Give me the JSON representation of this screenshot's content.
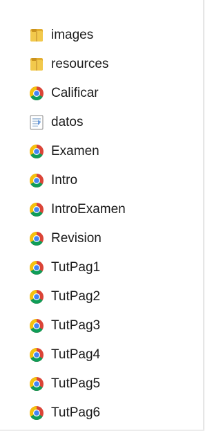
{
  "colors": {
    "folder": "#e8b93a",
    "chrome_red": "#db4437",
    "chrome_yellow": "#f4c20d",
    "chrome_green": "#0f9d58",
    "chrome_blue": "#4285f4"
  },
  "files": [
    {
      "name": "images",
      "icon": "folder-icon"
    },
    {
      "name": "resources",
      "icon": "folder-icon"
    },
    {
      "name": "Calificar",
      "icon": "chrome-html-icon"
    },
    {
      "name": "datos",
      "icon": "text-document-icon"
    },
    {
      "name": "Examen",
      "icon": "chrome-html-icon"
    },
    {
      "name": "Intro",
      "icon": "chrome-html-icon"
    },
    {
      "name": "IntroExamen",
      "icon": "chrome-html-icon"
    },
    {
      "name": "Revision",
      "icon": "chrome-html-icon"
    },
    {
      "name": "TutPag1",
      "icon": "chrome-html-icon"
    },
    {
      "name": "TutPag2",
      "icon": "chrome-html-icon"
    },
    {
      "name": "TutPag3",
      "icon": "chrome-html-icon"
    },
    {
      "name": "TutPag4",
      "icon": "chrome-html-icon"
    },
    {
      "name": "TutPag5",
      "icon": "chrome-html-icon"
    },
    {
      "name": "TutPag6",
      "icon": "chrome-html-icon"
    }
  ]
}
